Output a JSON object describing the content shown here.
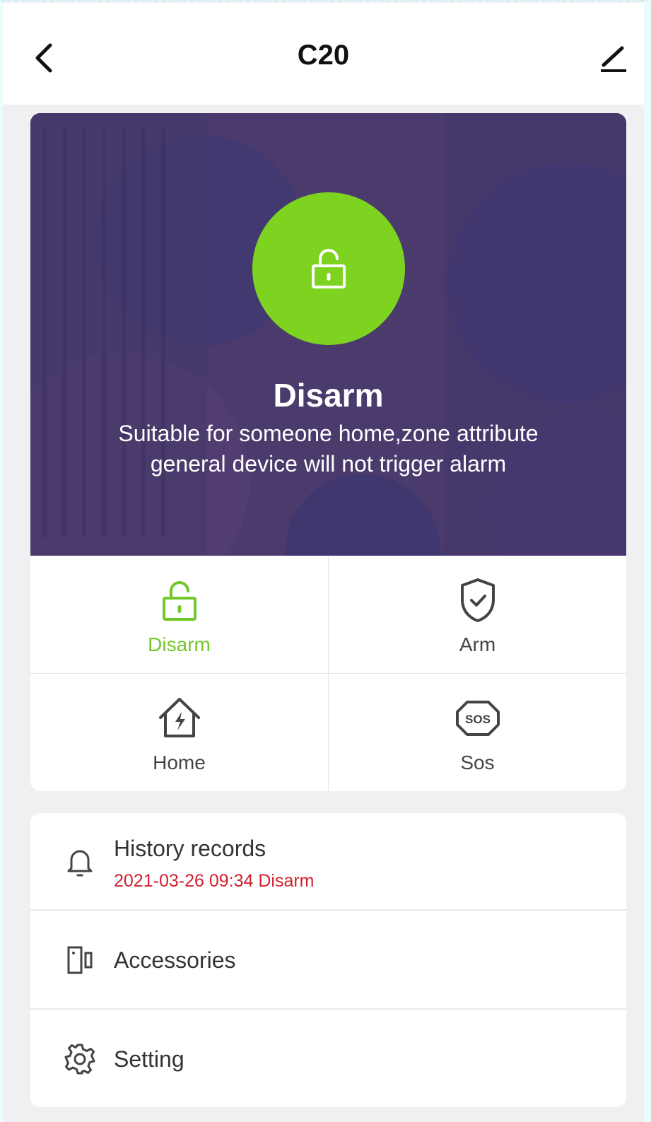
{
  "header": {
    "title": "C20"
  },
  "status": {
    "title": "Disarm",
    "description_line1": "Suitable for someone home,zone attribute",
    "description_line2": "general device will not trigger alarm",
    "accent_color": "#7ed321",
    "icon": "unlock-icon"
  },
  "modes": [
    {
      "label": "Disarm",
      "icon": "unlock-icon",
      "active": true
    },
    {
      "label": "Arm",
      "icon": "shield-check-icon",
      "active": false
    },
    {
      "label": "Home",
      "icon": "home-bolt-icon",
      "active": false
    },
    {
      "label": "Sos",
      "icon": "sos-icon",
      "active": false
    }
  ],
  "list": {
    "history": {
      "title": "History records",
      "subtitle": "2021-03-26 09:34 Disarm",
      "icon": "bell-icon"
    },
    "accessories": {
      "title": "Accessories",
      "icon": "door-sensor-icon"
    },
    "setting": {
      "title": "Setting",
      "icon": "gear-icon"
    }
  },
  "colors": {
    "active": "#72c72a",
    "alert_text": "#d0212f",
    "hero_bg": "#4a3b6c"
  }
}
